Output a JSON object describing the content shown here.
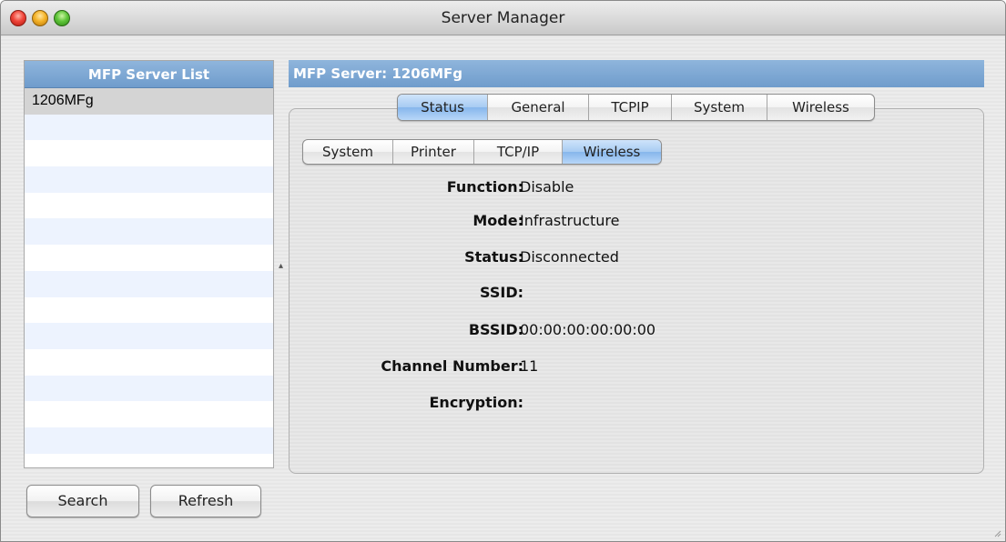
{
  "window": {
    "title": "Server Manager"
  },
  "server_list": {
    "header": "MFP Server List",
    "items": [
      "1206MFg"
    ]
  },
  "buttons": {
    "search_label": "Search",
    "refresh_label": "Refresh"
  },
  "server_panel": {
    "header": "MFP Server: 1206MFg"
  },
  "main_tabs": [
    {
      "label": "Status",
      "active": true
    },
    {
      "label": "General",
      "active": false
    },
    {
      "label": "TCPIP",
      "active": false
    },
    {
      "label": "System",
      "active": false
    },
    {
      "label": "Wireless",
      "active": false
    }
  ],
  "sub_tabs": [
    {
      "label": "System",
      "active": false
    },
    {
      "label": "Printer",
      "active": false
    },
    {
      "label": "TCP/IP",
      "active": false
    },
    {
      "label": "Wireless",
      "active": true
    }
  ],
  "wireless_status": {
    "function_label": "Function:",
    "function_value": "Disable",
    "mode_label": "Mode:",
    "mode_value": "Infrastructure",
    "status_label": "Status:",
    "status_value": "Disconnected",
    "ssid_label": "SSID:",
    "ssid_value": "",
    "bssid_label": "BSSID:",
    "bssid_value": "00:00:00:00:00:00",
    "channel_label": "Channel Number:",
    "channel_value": "11",
    "encryption_label": "Encryption:",
    "encryption_value": ""
  },
  "colors": {
    "header_blue": "#7fa8d4",
    "active_tab_blue": "#a7cbf2",
    "list_stripe": "#edf3fe",
    "selected_row": "#d4d4d4"
  }
}
